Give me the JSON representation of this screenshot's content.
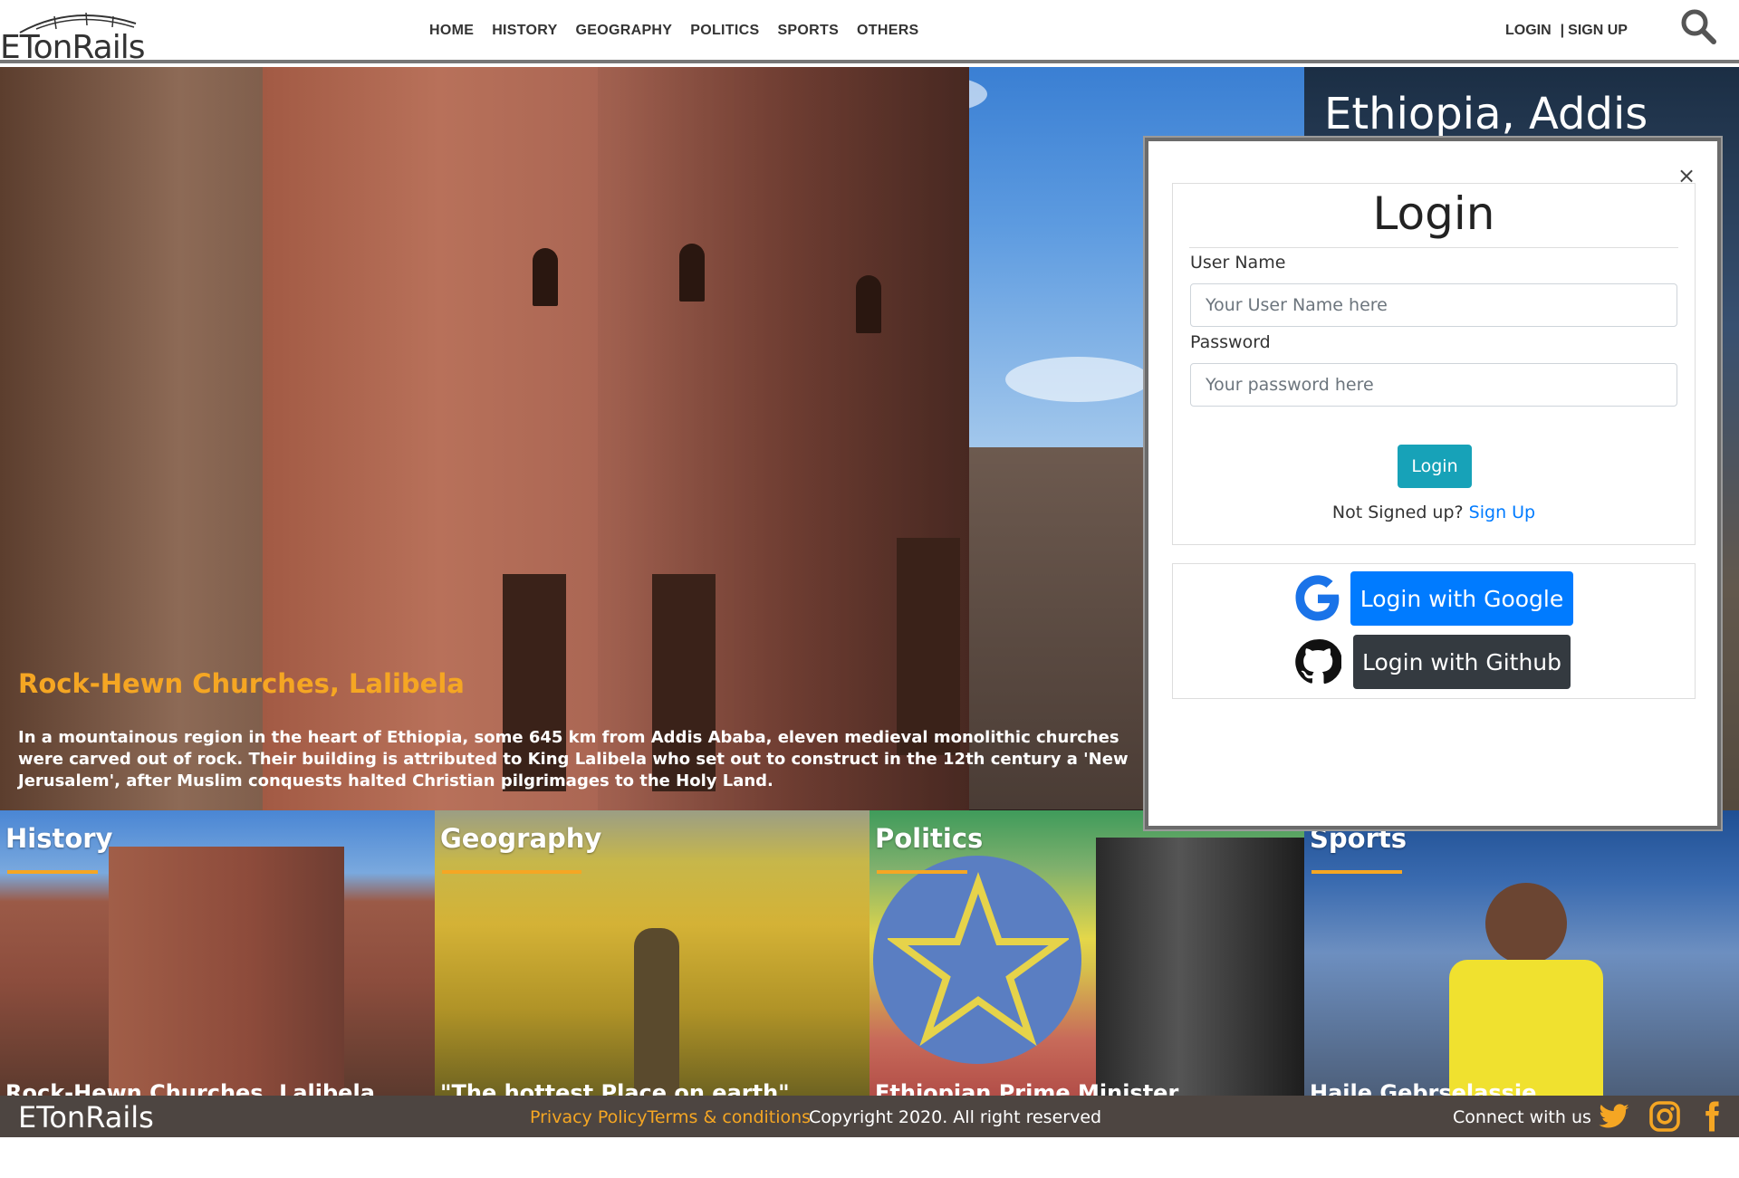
{
  "brand": {
    "name": "ETonRails"
  },
  "nav": {
    "items": [
      {
        "label": "HOME"
      },
      {
        "label": "HISTORY"
      },
      {
        "label": "GEOGRAPHY"
      },
      {
        "label": "POLITICS"
      },
      {
        "label": "SPORTS"
      },
      {
        "label": "OTHERS"
      }
    ]
  },
  "auth": {
    "login": "LOGIN",
    "separator": "|",
    "signup": "SIGN UP"
  },
  "icons": {
    "search": "search-icon",
    "close": "close-icon",
    "google": "google-icon",
    "github": "github-icon",
    "twitter": "twitter-icon",
    "instagram": "instagram-icon",
    "facebook": "facebook-icon"
  },
  "hero": {
    "title": "Rock-Hewn Churches, Lalibela",
    "description": "In a mountainous region in the heart of Ethiopia, some 645 km from Addis Ababa, eleven medieval monolithic churches were carved out of rock. Their building is attributed to King Lalibela who set out to construct in the 12th century a 'New Jerusalem', after Muslim conquests halted Christian pilgrimages to the Holy Land."
  },
  "side": {
    "title": "Ethiopia, Addis"
  },
  "tiles": [
    {
      "label": "History",
      "caption": "Rock-Hewn Churches, Lalibela"
    },
    {
      "label": "Geography",
      "caption": "\"The hottest Place on earth\""
    },
    {
      "label": "Politics",
      "caption": "Ethiopian Prime Minister"
    },
    {
      "label": "Sports",
      "caption": "Haile Gebrselassie"
    }
  ],
  "modal": {
    "title": "Login",
    "close": "×",
    "username_label": "User Name",
    "username_placeholder": "Your User Name here",
    "password_label": "Password",
    "password_placeholder": "Your password here",
    "submit": "Login",
    "not_signed": "Not Signed up?",
    "signup_link": "Sign Up",
    "google_button": "Login with Google",
    "github_button": "Login with Github"
  },
  "footer": {
    "brand": "ETonRails",
    "privacy": "Privacy Policy",
    "terms": "Terms & conditions",
    "copyright": "Copyright 2020. All right reserved",
    "connect": "Connect with us"
  },
  "colors": {
    "accent": "#f5a623",
    "teal": "#17a2b8",
    "blue": "#007bff",
    "dark": "#343a40",
    "footer": "#4d4541"
  }
}
